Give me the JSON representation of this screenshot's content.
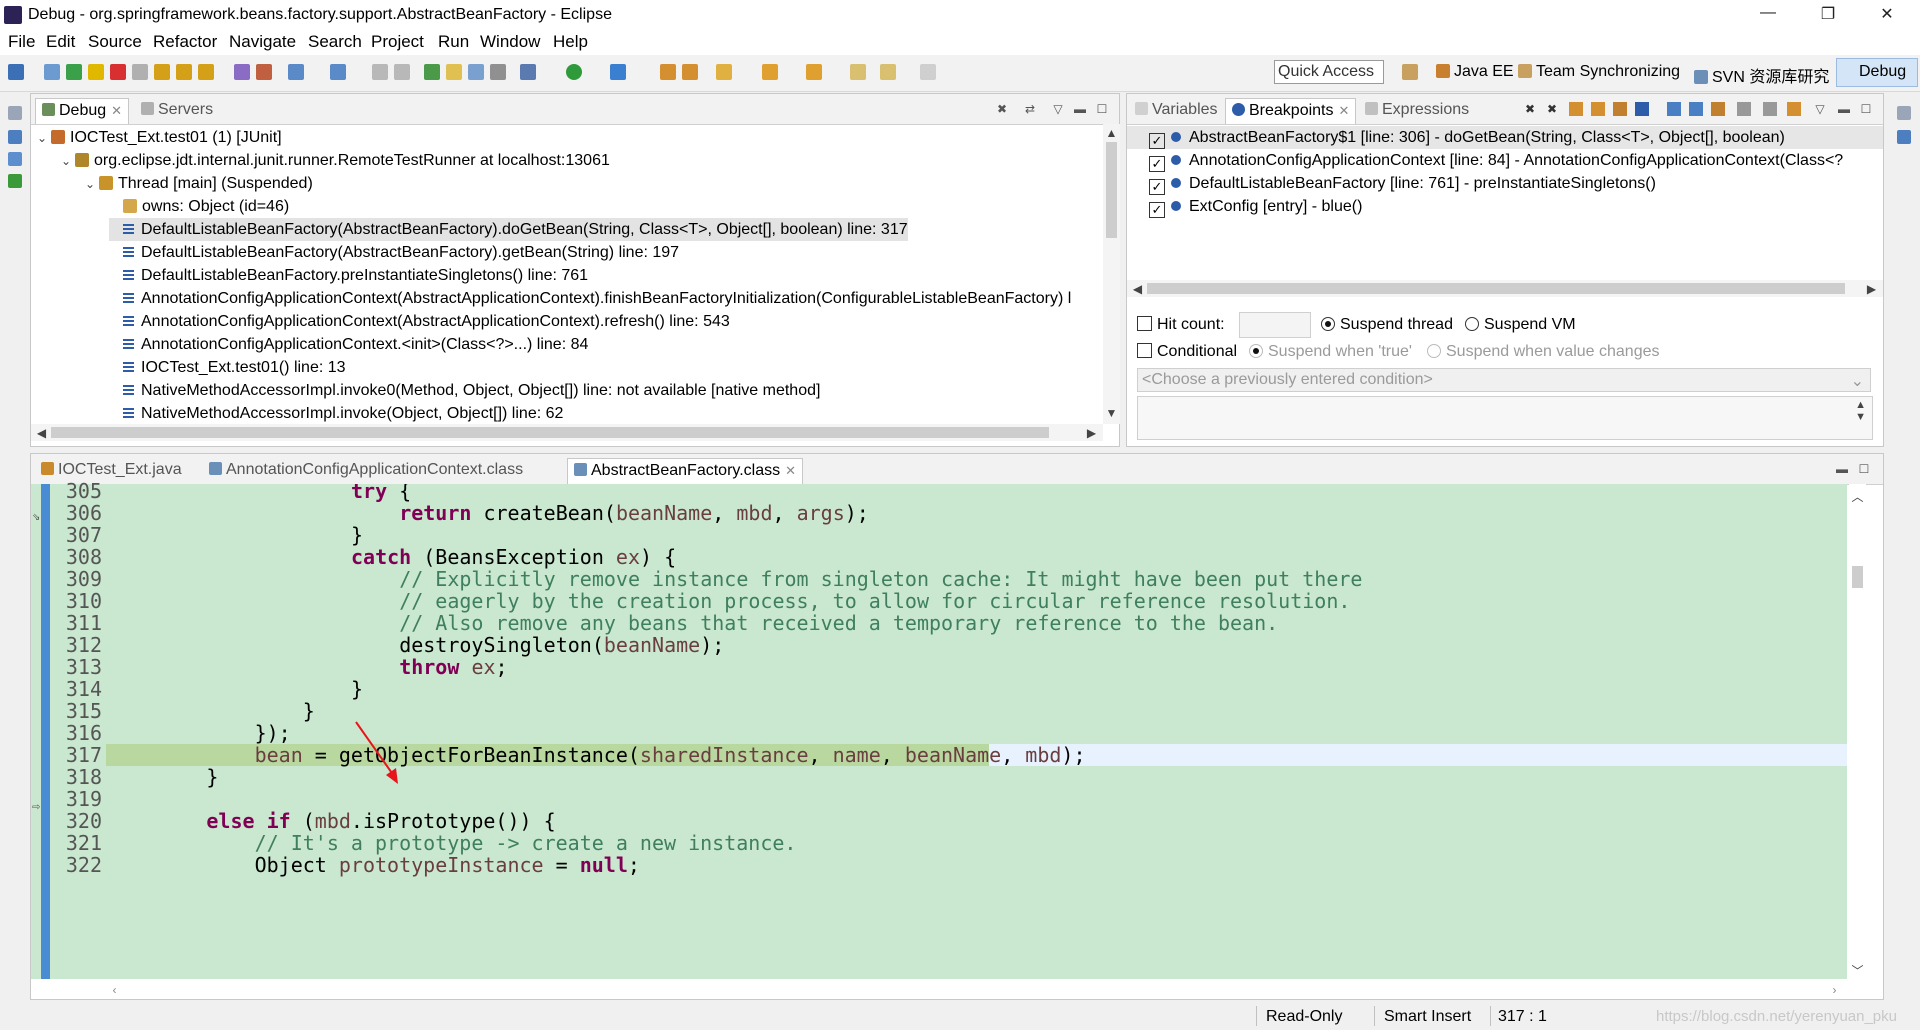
{
  "window": {
    "title": "Debug - org.springframework.beans.factory.support.AbstractBeanFactory - Eclipse",
    "controls": {
      "minimize": "—",
      "restore": "❐",
      "close": "✕"
    }
  },
  "menu": [
    "File",
    "Edit",
    "Source",
    "Refactor",
    "Navigate",
    "Search",
    "Project",
    "Run",
    "Window",
    "Help"
  ],
  "toolbar": {
    "quick_access": "Quick Access",
    "perspectives": [
      "Java EE",
      "Team Synchronizing",
      "SVN 资源库研究",
      "Debug"
    ]
  },
  "debug_view": {
    "tabs": [
      "Debug",
      "Servers"
    ],
    "tree": [
      {
        "level": 0,
        "arrow": "v",
        "text": "IOCTest_Ext.test01 (1) [JUnit]"
      },
      {
        "level": 1,
        "arrow": "v",
        "text": "org.eclipse.jdt.internal.junit.runner.RemoteTestRunner at localhost:13061"
      },
      {
        "level": 2,
        "arrow": "v",
        "text": "Thread [main] (Suspended)"
      },
      {
        "level": 3,
        "arrow": "",
        "text": "owns: Object  (id=46)"
      },
      {
        "level": 3,
        "arrow": "",
        "text": "DefaultListableBeanFactory(AbstractBeanFactory).doGetBean(String, Class<T>, Object[], boolean) line: 317"
      },
      {
        "level": 3,
        "arrow": "",
        "text": "DefaultListableBeanFactory(AbstractBeanFactory).getBean(String) line: 197"
      },
      {
        "level": 3,
        "arrow": "",
        "text": "DefaultListableBeanFactory.preInstantiateSingletons() line: 761"
      },
      {
        "level": 3,
        "arrow": "",
        "text": "AnnotationConfigApplicationContext(AbstractApplicationContext).finishBeanFactoryInitialization(ConfigurableListableBeanFactory) l"
      },
      {
        "level": 3,
        "arrow": "",
        "text": "AnnotationConfigApplicationContext(AbstractApplicationContext).refresh() line: 543"
      },
      {
        "level": 3,
        "arrow": "",
        "text": "AnnotationConfigApplicationContext.<init>(Class<?>...) line: 84"
      },
      {
        "level": 3,
        "arrow": "",
        "text": "IOCTest_Ext.test01() line: 13"
      },
      {
        "level": 3,
        "arrow": "",
        "text": "NativeMethodAccessorImpl.invoke0(Method, Object, Object[]) line: not available [native method]"
      },
      {
        "level": 3,
        "arrow": "",
        "text": "NativeMethodAccessorImpl.invoke(Object, Object[]) line: 62"
      }
    ]
  },
  "breakpoints_view": {
    "tabs": [
      "Variables",
      "Breakpoints",
      "Expressions"
    ],
    "items": [
      "AbstractBeanFactory$1 [line: 306] - doGetBean(String, Class<T>, Object[], boolean)",
      "AnnotationConfigApplicationContext [line: 84] - AnnotationConfigApplicationContext(Class<?",
      "DefaultListableBeanFactory [line: 761] - preInstantiateSingletons()",
      "ExtConfig [entry] - blue()"
    ],
    "hit_count": "Hit count:",
    "suspend_thread": "Suspend thread",
    "suspend_vm": "Suspend VM",
    "conditional": "Conditional",
    "suspend_true": "Suspend when 'true'",
    "suspend_change": "Suspend when value changes",
    "condition_placeholder": "<Choose a previously entered condition>"
  },
  "editor": {
    "tabs": [
      "IOCTest_Ext.java",
      "AnnotationConfigApplicationContext.class",
      "AbstractBeanFactory.class"
    ],
    "lines": [
      {
        "n": "305",
        "indent": 20,
        "tokens": [
          [
            "kw",
            "try"
          ],
          [
            "",
            "{"
          ]
        ]
      },
      {
        "n": "306",
        "indent": 24,
        "tokens": [
          [
            "kw",
            "return"
          ],
          [
            "",
            " createBean("
          ],
          [
            "vr",
            "beanName"
          ],
          [
            "",
            ", "
          ],
          [
            "vr",
            "mbd"
          ],
          [
            "",
            ", "
          ],
          [
            "vr",
            "args"
          ],
          [
            "",
            ");"
          ]
        ]
      },
      {
        "n": "307",
        "indent": 20,
        "tokens": [
          [
            "",
            "}"
          ]
        ]
      },
      {
        "n": "308",
        "indent": 20,
        "tokens": [
          [
            "kw",
            "catch"
          ],
          [
            "",
            " (BeansException "
          ],
          [
            "vr",
            "ex"
          ],
          [
            "",
            ") {"
          ]
        ]
      },
      {
        "n": "309",
        "indent": 24,
        "tokens": [
          [
            "cm",
            "// Explicitly remove instance from singleton cache: It might have been put there"
          ]
        ]
      },
      {
        "n": "310",
        "indent": 24,
        "tokens": [
          [
            "cm",
            "// eagerly by the creation process, to allow for circular reference resolution."
          ]
        ]
      },
      {
        "n": "311",
        "indent": 24,
        "tokens": [
          [
            "cm",
            "// Also remove any beans that received a temporary reference to the bean."
          ]
        ]
      },
      {
        "n": "312",
        "indent": 24,
        "tokens": [
          [
            "",
            "destroySingleton("
          ],
          [
            "vr",
            "beanName"
          ],
          [
            "",
            ");"
          ]
        ]
      },
      {
        "n": "313",
        "indent": 24,
        "tokens": [
          [
            "kw",
            "throw"
          ],
          [
            "",
            ""
          ],
          [
            "vr",
            " ex"
          ],
          [
            "",
            ";"
          ]
        ]
      },
      {
        "n": "314",
        "indent": 20,
        "tokens": [
          [
            "",
            "}"
          ]
        ]
      },
      {
        "n": "315",
        "indent": 16,
        "tokens": [
          [
            "",
            "}"
          ]
        ]
      },
      {
        "n": "316",
        "indent": 12,
        "tokens": [
          [
            "",
            "});"
          ]
        ]
      },
      {
        "n": "317",
        "indent": 12,
        "tokens": [
          [
            "vr",
            "bean"
          ],
          [
            "",
            " = getObjectForBeanInstance("
          ],
          [
            "vr",
            "sharedInstance"
          ],
          [
            "",
            ", "
          ],
          [
            "vr",
            "name"
          ],
          [
            "",
            ", "
          ],
          [
            "vr",
            "beanName"
          ],
          [
            "",
            ", "
          ],
          [
            "vr",
            "mbd"
          ],
          [
            "",
            ");"
          ]
        ]
      },
      {
        "n": "318",
        "indent": 8,
        "tokens": [
          [
            "",
            "}"
          ]
        ]
      },
      {
        "n": "319",
        "indent": 0,
        "tokens": []
      },
      {
        "n": "320",
        "indent": 8,
        "tokens": [
          [
            "kw",
            "else if"
          ],
          [
            "",
            " ("
          ],
          [
            "vr",
            "mbd"
          ],
          [
            "",
            ".isPrototype()) {"
          ]
        ]
      },
      {
        "n": "321",
        "indent": 12,
        "tokens": [
          [
            "cm",
            "// It's a prototype -> create a new instance."
          ]
        ]
      },
      {
        "n": "322",
        "indent": 12,
        "tokens": [
          [
            "",
            "Object "
          ],
          [
            "vr",
            "prototypeInstance"
          ],
          [
            "",
            " = "
          ],
          [
            "kw",
            "null"
          ],
          [
            "",
            ";"
          ]
        ]
      }
    ],
    "current_line": "317"
  },
  "status": {
    "mode": "Read-Only",
    "insert": "Smart Insert",
    "position": "317 : 1",
    "watermark": "https://blog.csdn.net/yerenyuan_pku"
  },
  "colors": {
    "editor_bg": "#c9e8cf",
    "keyword": "#7f0055",
    "comment": "#3f7f5f",
    "variable": "#6a3e3e",
    "annotation_arrow": "#e8141c"
  }
}
